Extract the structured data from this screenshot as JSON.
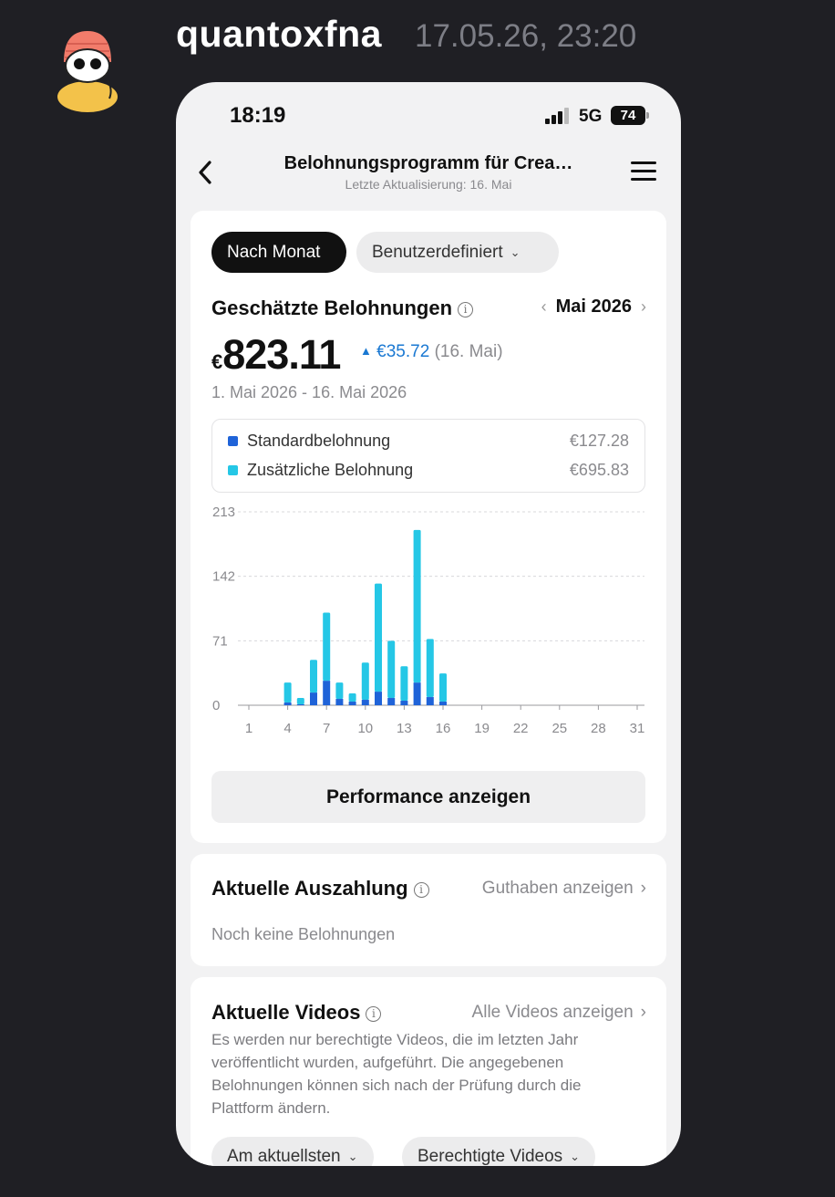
{
  "post": {
    "username": "quantoxfna",
    "timestamp": "17.05.26, 23:20"
  },
  "status_bar": {
    "time": "18:19",
    "network": "5G",
    "battery": "74"
  },
  "header": {
    "title": "Belohnungsprogramm für Crea…",
    "subtitle": "Letzte Aktualisierung: 16. Mai"
  },
  "filters": {
    "active": "Nach Monat",
    "inactive": "Benutzerdefiniert"
  },
  "rewards": {
    "title": "Geschätzte Belohnungen",
    "month": "Mai 2026",
    "prev_arrow": "‹",
    "next_arrow": "›",
    "currency": "€",
    "amount": "823.11",
    "delta_arrow": "▲",
    "delta": "€35.72",
    "delta_date": "(16. Mai)",
    "date_range": "1. Mai 2026 - 16. Mai 2026"
  },
  "legend": [
    {
      "label": "Standardbelohnung",
      "amount": "€127.28",
      "color": "#1f63d8"
    },
    {
      "label": "Zusätzliche Belohnung",
      "amount": "€695.83",
      "color": "#25c7e6"
    }
  ],
  "chart_data": {
    "type": "bar",
    "stacked": true,
    "y_ticks": [
      "213",
      "142",
      "71",
      "0"
    ],
    "ylim": [
      0,
      213
    ],
    "x_ticks": [
      "1",
      "4",
      "7",
      "10",
      "13",
      "16",
      "19",
      "22",
      "25",
      "28",
      "31"
    ],
    "xlim": [
      1,
      31
    ],
    "grid": true,
    "days": [
      4,
      5,
      6,
      7,
      8,
      9,
      10,
      11,
      12,
      13,
      14,
      15,
      16
    ],
    "series": [
      {
        "name": "Standardbelohnung",
        "color": "#1f63d8",
        "values": [
          3,
          1,
          14,
          27,
          7,
          4,
          6,
          15,
          8,
          5,
          25,
          9,
          4
        ]
      },
      {
        "name": "Zusätzliche Belohnung",
        "color": "#25c7e6",
        "values": [
          22,
          7,
          36,
          75,
          18,
          9,
          41,
          119,
          63,
          38,
          168,
          64,
          31
        ]
      }
    ]
  },
  "performance_button": "Performance anzeigen",
  "payout": {
    "title": "Aktuelle Auszahlung",
    "link": "Guthaben anzeigen",
    "empty": "Noch keine Belohnungen"
  },
  "videos": {
    "title": "Aktuelle Videos",
    "link": "Alle Videos anzeigen",
    "description": "Es werden nur berechtigte Videos, die im letzten Jahr veröffentlicht wurden, aufgeführt. Die angegebenen Belohnungen können sich nach der Prüfung durch die Plattform ändern.",
    "chip_sort": "Am aktuellsten",
    "chip_filter": "Berechtigte Videos"
  }
}
